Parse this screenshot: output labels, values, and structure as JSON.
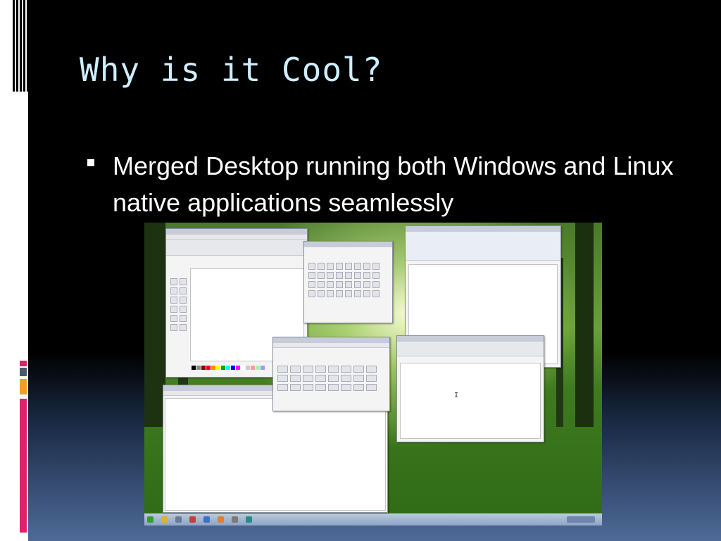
{
  "slide": {
    "title": "Why is it Cool?",
    "bullets": [
      "Merged Desktop running both Windows and Linux native applications seamlessly"
    ]
  },
  "colors": {
    "title": "#cfeeff",
    "text": "#ffffff",
    "accent_pink": "#e0206a",
    "accent_orange": "#f0a020",
    "accent_slate": "#4a5a6a"
  },
  "screenshot": {
    "description_icon": "desktop-screenshot-icon",
    "text_cursor": "I"
  }
}
